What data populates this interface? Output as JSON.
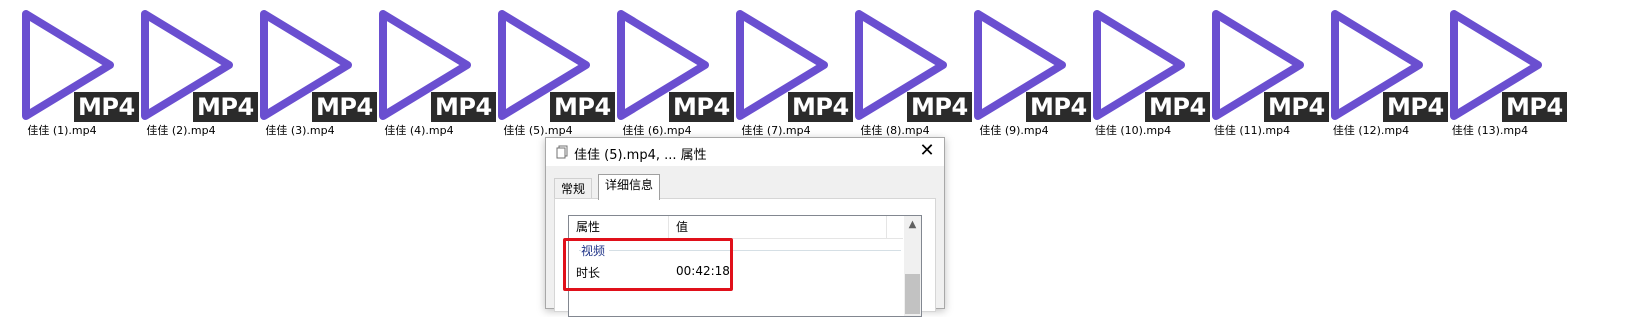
{
  "files": [
    {
      "name": "佳佳 (1).mp4"
    },
    {
      "name": "佳佳 (2).mp4"
    },
    {
      "name": "佳佳 (3).mp4"
    },
    {
      "name": "佳佳 (4).mp4"
    },
    {
      "name": "佳佳 (5).mp4"
    },
    {
      "name": "佳佳 (6).mp4"
    },
    {
      "name": "佳佳 (7).mp4"
    },
    {
      "name": "佳佳 (8).mp4"
    },
    {
      "name": "佳佳 (9).mp4"
    },
    {
      "name": "佳佳 (10).mp4"
    },
    {
      "name": "佳佳 (11).mp4"
    },
    {
      "name": "佳佳 (12).mp4"
    },
    {
      "name": "佳佳 (13).mp4"
    }
  ],
  "file_icon": {
    "name": "video-play-icon",
    "badge": "MP4",
    "color": "#6a4fd0",
    "badge_bg": "#2b2b2b"
  },
  "dialog": {
    "title": "佳佳 (5).mp4, ... 属性",
    "tabs": [
      "常规",
      "详细信息"
    ],
    "active_tab": "详细信息",
    "columns": [
      "属性",
      "值"
    ],
    "group": "视频",
    "rows": [
      {
        "property": "时长",
        "value": "00:42:18"
      }
    ]
  },
  "highlight_color": "#e0101a"
}
